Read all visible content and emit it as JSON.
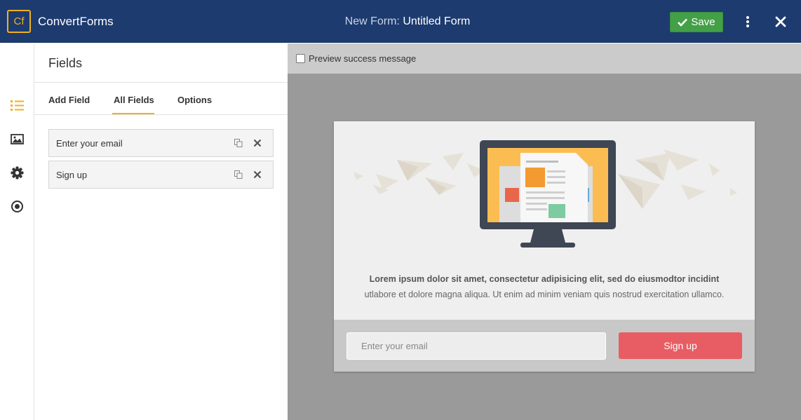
{
  "header": {
    "logo_text": "Cf",
    "brand": "ConvertForms",
    "title_prefix": "New Form:",
    "title_name": "Untitled Form",
    "save_label": "Save",
    "accent": "#f2b01e",
    "bar_color": "#1d3b6f",
    "save_color": "#43a047"
  },
  "rail": {
    "icons": [
      "list-icon",
      "image-icon",
      "gear-icon",
      "target-icon"
    ],
    "active": "list-icon"
  },
  "panel": {
    "title": "Fields",
    "tabs": [
      {
        "label": "Add Field"
      },
      {
        "label": "All Fields",
        "active": true
      },
      {
        "label": "Options"
      }
    ],
    "fields": [
      {
        "label": "Enter your email"
      },
      {
        "label": "Sign up"
      }
    ]
  },
  "preview": {
    "success_label": "Preview success message",
    "success_checked": false,
    "text_bold": "Lorem ipsum dolor sit amet, consectetur adipisicing elit, sed do eiusmodtor incidint",
    "text_normal": "utlabore et dolore magna aliqua. Ut enim ad minim veniam quis nostrud exercitation ullamco.",
    "email_placeholder": "Enter your email",
    "button_label": "Sign up",
    "button_color": "#e85d63"
  }
}
